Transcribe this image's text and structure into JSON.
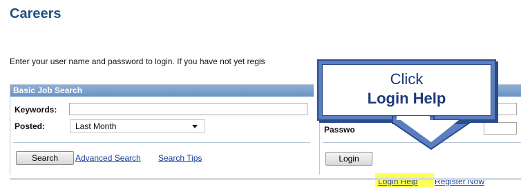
{
  "page": {
    "title": "Careers",
    "intro": "Enter your user name and password to login. If you have not yet regis"
  },
  "job_search": {
    "header": "Basic Job Search",
    "keywords_label": "Keywords:",
    "keywords_value": "",
    "posted_label": "Posted:",
    "posted_value": "Last Month",
    "search_button": "Search",
    "advanced_search_link": "Advanced Search",
    "search_tips_link": "Search Tips"
  },
  "login": {
    "password_label": "Passwo",
    "username_value": "",
    "password_value": "",
    "login_button": "Login",
    "login_help_link": "Login Help",
    "register_link": "Register Now"
  },
  "callout": {
    "line1": "Click",
    "line2": "Login Help"
  },
  "colors": {
    "title": "#1f4e83",
    "panel_header": "#7aa0cc",
    "callout_border": "#2b4b8b",
    "highlight": "#ffff55"
  }
}
